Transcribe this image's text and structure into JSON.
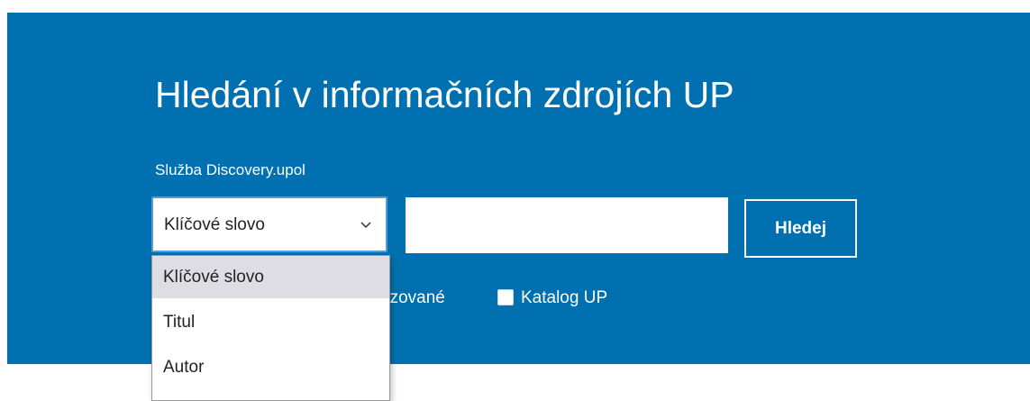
{
  "search_panel": {
    "title": "Hledání v informačních zdrojích UP",
    "service_label": "Služba Discovery.upol",
    "field_select": {
      "selected_value": "Klíčové slovo",
      "options": [
        "Klíčové slovo",
        "Titul",
        "Autor"
      ],
      "expanded": true
    },
    "search_input": {
      "value": "",
      "placeholder": ""
    },
    "search_button_label": "Hledej",
    "filters": [
      {
        "label_visible_part": "nzované",
        "checked": false
      },
      {
        "label": "Katalog UP",
        "checked": false
      }
    ]
  },
  "colors": {
    "panel_background": "#0070b0",
    "text_on_panel": "#ffffff",
    "selected_option_background": "#dedde3",
    "select_focus_border": "#5b9bd5"
  },
  "icons": {
    "select_chevron": "chevron-down-icon",
    "checkbox": "checkbox-unchecked-icon"
  }
}
